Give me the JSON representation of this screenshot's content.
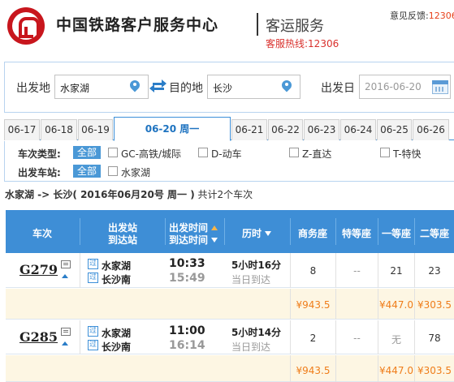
{
  "header": {
    "site_title": "中国铁路客户服务中心",
    "service_name": "客运服务",
    "hotline": "客服热线:12306",
    "feedback_label": "意见反馈:",
    "feedback_value": "12306"
  },
  "search": {
    "from_label": "出发地",
    "from_value": "水家湖",
    "to_label": "目的地",
    "to_value": "长沙",
    "date_label": "出发日",
    "date_value": "2016-06-20"
  },
  "date_tabs": [
    "06-17",
    "06-18",
    "06-19",
    "06-20 周一",
    "06-21",
    "06-22",
    "06-23",
    "06-24",
    "06-25",
    "06-26"
  ],
  "active_tab": "06-20 周一",
  "filters": {
    "type_label": "车次类型:",
    "all_label": "全部",
    "types": [
      "GC-高铁/城际",
      "D-动车",
      "Z-直达",
      "T-特快"
    ],
    "station_label": "出发车站:",
    "stations": [
      "水家湖"
    ]
  },
  "summary": {
    "route": "水家湖 -> 长沙",
    "date": "( 2016年06月20号  周一 )",
    "count": "共计2个车次"
  },
  "table": {
    "headers": {
      "train": "车次",
      "station_from": "出发站",
      "station_to": "到达站",
      "time_dep": "出发时间",
      "time_arr": "到达时间",
      "duration": "历时",
      "business": "商务座",
      "premium": "特等座",
      "first": "一等座",
      "second": "二等座"
    },
    "rows": [
      {
        "train": "G279",
        "from_tag": "过",
        "from": "水家湖",
        "to_tag": "过",
        "to": "长沙南",
        "dep": "10:33",
        "arr": "15:49",
        "duration": "5小时16分",
        "arrival_note": "当日到达",
        "business": "8",
        "premium": "--",
        "first": "21",
        "second": "23",
        "price_business": "¥943.5",
        "price_first": "¥447.0",
        "price_second": "¥303.5"
      },
      {
        "train": "G285",
        "from_tag": "过",
        "from": "水家湖",
        "to_tag": "过",
        "to": "长沙南",
        "dep": "11:00",
        "arr": "16:14",
        "duration": "5小时14分",
        "arrival_note": "当日到达",
        "business": "2",
        "premium": "--",
        "first": "无",
        "second": "78",
        "price_business": "¥943.5",
        "price_first": "¥447.0",
        "price_second": "¥303.5"
      }
    ]
  },
  "colors": {
    "brand_red": "#c8161d",
    "accent_blue": "#3e8ed6",
    "price_orange": "#ef7d1a"
  }
}
